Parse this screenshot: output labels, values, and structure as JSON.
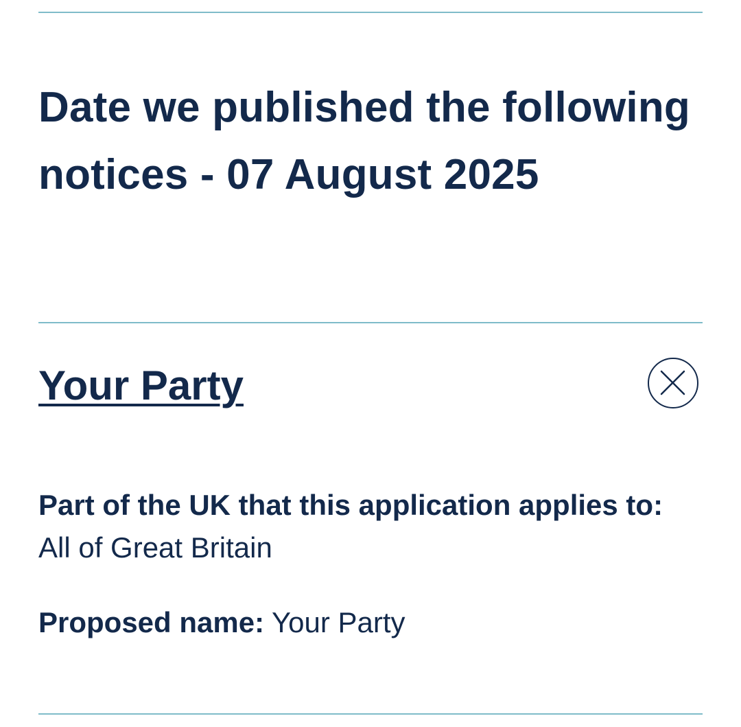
{
  "heading": "Date we published the following notices - 07 August 2025",
  "notice": {
    "title": "Your Party",
    "close_icon": "close-circle-icon",
    "fields": [
      {
        "label": "Part of the UK that this application applies to:",
        "value": "All of Great Britain"
      },
      {
        "label": "Proposed name:",
        "value": "Your Party"
      }
    ]
  },
  "colors": {
    "text": "#13294b",
    "divider": "#7fbcc9",
    "background": "#ffffff"
  }
}
